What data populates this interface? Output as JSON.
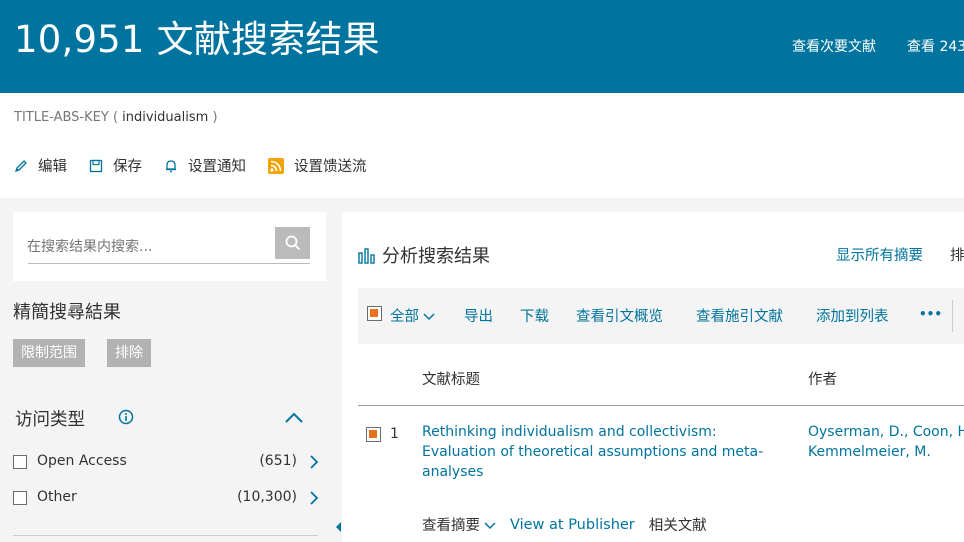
{
  "header": {
    "title": "10,951 文献搜索结果",
    "link_secondary_docs": "查看次要文献",
    "link_view_more": "查看 243"
  },
  "query": {
    "field": "TITLE-ABS-KEY",
    "open": "(",
    "keyword": "individualism",
    "close": ")"
  },
  "actions": {
    "edit": "编辑",
    "save": "保存",
    "set_alert": "设置通知",
    "set_feed": "设置馈送流"
  },
  "search_within": {
    "placeholder": "在搜索结果内搜索..."
  },
  "refine": {
    "title": "精簡搜尋結果",
    "limit_to": "限制范围",
    "exclude": "排除"
  },
  "facet_access": {
    "title": "访问类型",
    "items": [
      {
        "label": "Open Access",
        "count": "(651)"
      },
      {
        "label": "Other",
        "count": "(10,300)"
      }
    ]
  },
  "results": {
    "analyze_label": "分析搜索结果",
    "show_all_abstracts": "显示所有摘要",
    "sort_cut": "排",
    "toolbar": {
      "all": "全部",
      "export": "导出",
      "download": "下载",
      "citation_overview": "查看引文概览",
      "cited_by": "查看施引文献",
      "add_to_list": "添加到列表",
      "more": "•••"
    },
    "columns": {
      "title": "文献标题",
      "authors": "作者"
    },
    "rows": [
      {
        "num": "1",
        "title": "Rethinking individualism and collectivism: Evaluation of theoretical assumptions and meta-analyses",
        "authors": "Oyserman, D., Coon, H. Kemmelmeier, M.",
        "view_abstract": "查看摘要",
        "view_at_publisher": "View at Publisher",
        "related_docs": "相关文献"
      }
    ]
  },
  "colors": {
    "header_bg": "#00749e",
    "link": "#00749e",
    "accent_checkbox": "#e9711c",
    "feed_icon": "#f0a30a"
  }
}
